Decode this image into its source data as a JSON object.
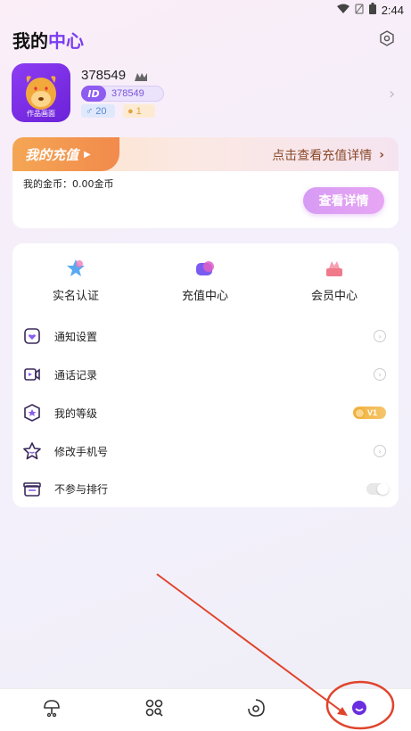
{
  "status_bar": {
    "time": "2:44"
  },
  "header": {
    "title_part1": "我的",
    "title_part2": "中心"
  },
  "profile": {
    "username": "378549",
    "id_tag": "ID",
    "id_value": "378549",
    "likes": "20",
    "coins": "1",
    "avatar_caption": "作品画面"
  },
  "recharge": {
    "tab_label": "我的充值",
    "link_label": "点击查看充值详情",
    "coins_text": "我的金币：0.00金币",
    "detail_button": "查看详情"
  },
  "quick_actions": [
    {
      "label": "实名认证",
      "icon": "star-badge-icon"
    },
    {
      "label": "充值中心",
      "icon": "wallet-icon"
    },
    {
      "label": "会员中心",
      "icon": "crown-icon"
    }
  ],
  "menu": [
    {
      "label": "通知设置",
      "icon": "shield-heart-icon"
    },
    {
      "label": "通话记录",
      "icon": "video-call-icon"
    },
    {
      "label": "我的等级",
      "icon": "level-star-icon",
      "badge": "V1"
    },
    {
      "label": "修改手机号",
      "icon": "star-outline-icon"
    },
    {
      "label": "不参与排行",
      "icon": "gift-box-icon",
      "toggle": false
    }
  ],
  "tabbar": [
    {
      "name": "home-tab",
      "icon": "planet-icon"
    },
    {
      "name": "discover-tab",
      "icon": "grid-search-icon"
    },
    {
      "name": "moments-tab",
      "icon": "spiral-icon"
    },
    {
      "name": "me-tab",
      "icon": "smile-face-icon",
      "active": true
    }
  ],
  "colors": {
    "accent": "#7a3df0",
    "recharge_orange": "#f28a4c",
    "detail_button": "#d69bf4",
    "annotation_red": "#e0442c"
  }
}
